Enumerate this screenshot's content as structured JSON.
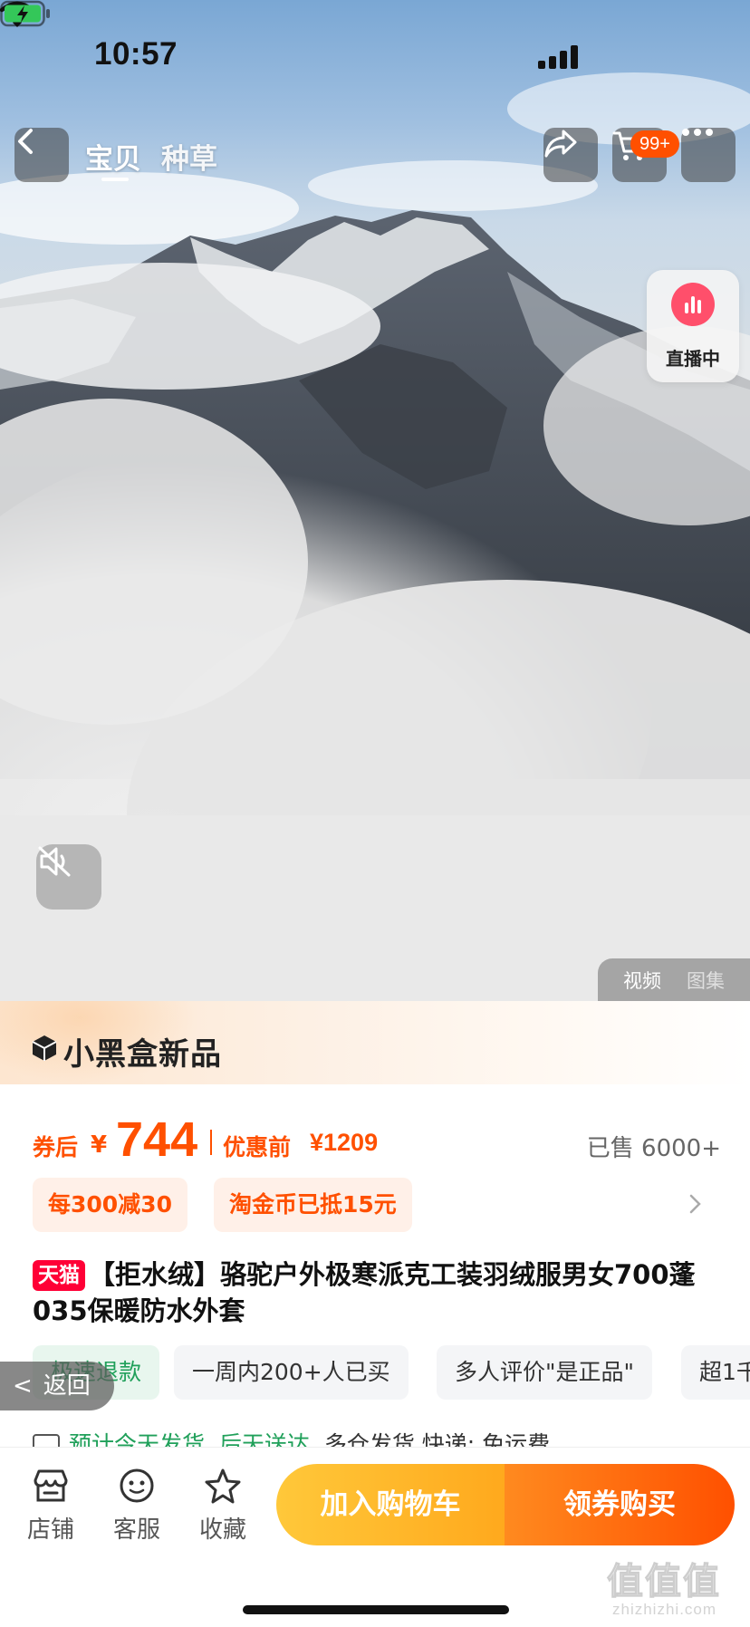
{
  "status_bar": {
    "time": "10:57"
  },
  "nav": {
    "tabs": [
      {
        "label": "宝贝",
        "active": true
      },
      {
        "label": "种草",
        "active": false
      }
    ],
    "cart_badge": "99+"
  },
  "media": {
    "live_label": "直播中",
    "toggle": [
      {
        "label": "视频",
        "active": true
      },
      {
        "label": "图集",
        "active": false
      }
    ]
  },
  "brand": {
    "name": "小黑盒新品"
  },
  "price": {
    "after_coupon_label": "券后",
    "currency": "¥",
    "after_coupon": "744",
    "before_label": "优惠前",
    "before_value": "¥1209",
    "sold": "已售 6000+"
  },
  "promos": [
    "每300减30",
    "淘金币已抵15元"
  ],
  "product": {
    "store_badge": "天猫",
    "title": "【拒水绒】骆驼户外极寒派克工装羽绒服男女700蓬035保暖防水外套"
  },
  "tags": [
    "极速退款",
    "一周内200+人已买",
    "多人评价\"是正品\"",
    "超1千"
  ],
  "back_float": "返回",
  "delivery": {
    "ship": "预计今天发货",
    "arrive": "后天送达",
    "rest": "多仓发货 快递: 免运费"
  },
  "bottom_bar": {
    "shop": "店铺",
    "service": "客服",
    "favorite": "收藏",
    "add_to_cart": "加入购物车",
    "buy": "领券购买"
  },
  "watermark": {
    "big": "值值值",
    "small": "zhizhizhi.com"
  },
  "colors": {
    "accent": "#ff5000",
    "tmall": "#ff0036",
    "green": "#20a05a",
    "cart_btn": "#ffb52a"
  }
}
